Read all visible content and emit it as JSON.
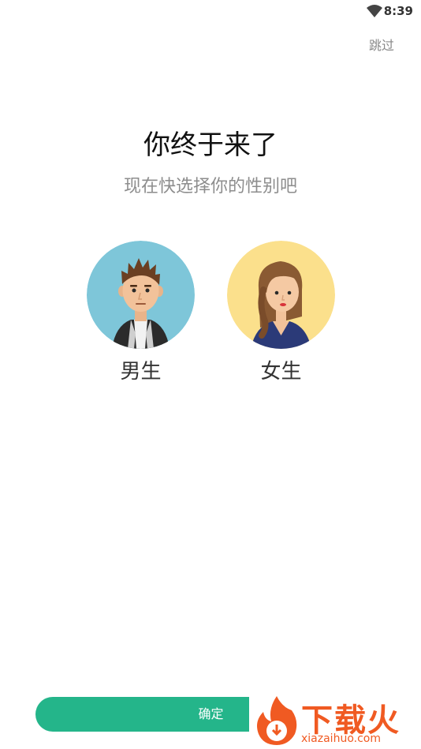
{
  "status_bar": {
    "time": "8:39",
    "wifi_icon": "wifi-icon"
  },
  "header": {
    "skip_label": "跳过"
  },
  "main": {
    "title": "你终于来了",
    "subtitle": "现在快选择你的性别吧",
    "options": [
      {
        "label": "男生",
        "avatar_icon": "male-avatar-icon",
        "bg_color": "#7ec6d9"
      },
      {
        "label": "女生",
        "avatar_icon": "female-avatar-icon",
        "bg_color": "#fbe08c"
      }
    ]
  },
  "footer": {
    "confirm_label": "确定",
    "accent_color": "#24b58a"
  },
  "watermark": {
    "name": "下载火",
    "url": "xiazaihuo.com"
  }
}
